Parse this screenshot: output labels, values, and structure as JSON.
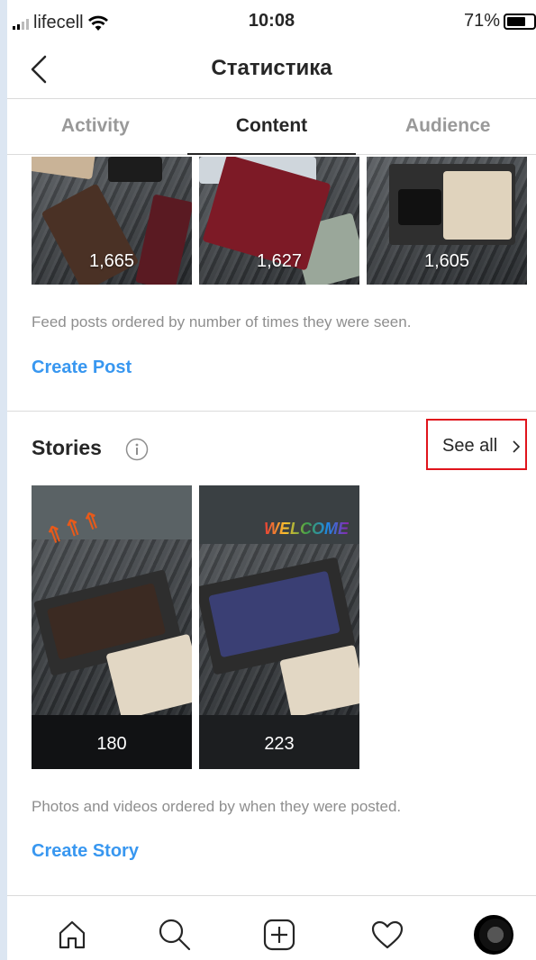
{
  "status_bar": {
    "carrier": "lifecell",
    "time": "10:08",
    "battery": "71%",
    "battery_level": 0.71
  },
  "header": {
    "title": "Статистика",
    "back_icon": "chevron-left-icon"
  },
  "tabs": [
    {
      "label": "Activity",
      "active": false
    },
    {
      "label": "Content",
      "active": true
    },
    {
      "label": "Audience",
      "active": false
    }
  ],
  "feed": {
    "posts": [
      {
        "count": "1,665"
      },
      {
        "count": "1,627"
      },
      {
        "count": "1,605"
      }
    ],
    "description": "Feed posts ordered by number of times they were seen.",
    "create_label": "Create Post"
  },
  "stories": {
    "title": "Stories",
    "info_icon": "info-icon",
    "see_all_label": "See all",
    "items": [
      {
        "count": "180"
      },
      {
        "count": "223"
      }
    ],
    "description": "Photos and videos ordered by when they were posted.",
    "create_label": "Create Story"
  },
  "tabbar": {
    "icons": [
      "home-icon",
      "search-icon",
      "new-post-icon",
      "activity-heart-icon",
      "profile-avatar"
    ]
  },
  "colors": {
    "accent": "#3897f0",
    "highlight_box": "#e0141c",
    "muted": "#8e8e8e"
  }
}
